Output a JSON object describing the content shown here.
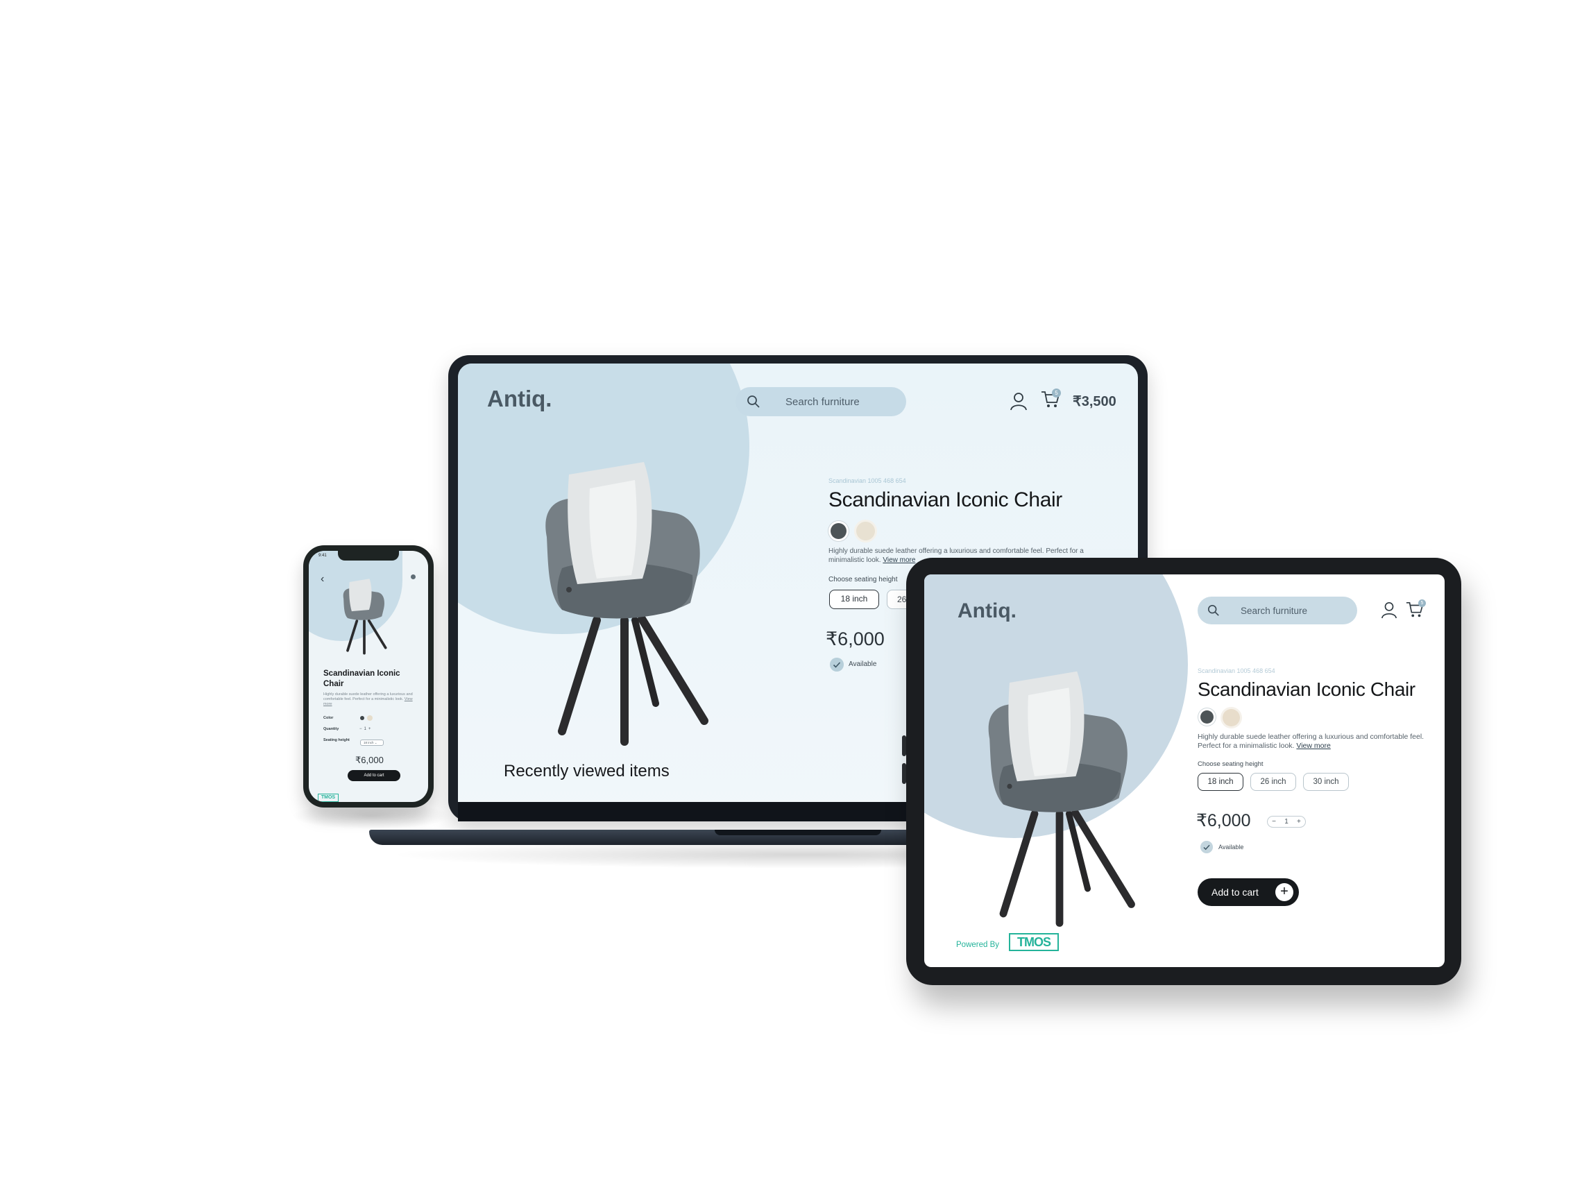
{
  "laptop": {
    "logo": "Antiq.",
    "search_placeholder": "Search furniture",
    "cart_badge": "5",
    "cart_total": "₹3,500",
    "sku": "Scandinavian 1005 468 654",
    "title": "Scandinavian Iconic Chair",
    "description": "Highly durable suede leather offering a luxurious and comfortable feel. Perfect for a minimalistic look.",
    "view_more": "View more",
    "seating_label": "Choose seating height",
    "seating_options": [
      "18 inch",
      "26 inch"
    ],
    "price": "₹6,000",
    "availability": "Available",
    "recently_viewed": "Recently viewed items",
    "colors": [
      "#4d5457",
      "#e8e1d2"
    ]
  },
  "phone": {
    "status_time": "9:41",
    "title": "Scandinavian Iconic Chair",
    "description": "Highly durable suede leather offering a luxurious and comfortable feel. Perfect for a minimalistic look.",
    "view_more": "View more",
    "color_label": "Color",
    "quantity_label": "Quantity",
    "quantity_value": "1",
    "seating_label": "Seating height",
    "seating_value": "18 inch",
    "price": "₹6,000",
    "add_to_cart": "Add to cart",
    "brand": "TMOS"
  },
  "tablet": {
    "logo": "Antiq.",
    "search_placeholder": "Search furniture",
    "cart_badge": "5",
    "sku": "Scandinavian 1005 468 654",
    "title": "Scandinavian Iconic Chair",
    "description": "Highly durable suede leather offering a luxurious and comfortable feel. Perfect for a minimalistic look.",
    "view_more": "View more",
    "seating_label": "Choose seating height",
    "seating_options": [
      "18 inch",
      "26 inch",
      "30 inch"
    ],
    "price": "₹6,000",
    "quantity_value": "1",
    "availability": "Available",
    "add_to_cart": "Add to cart",
    "powered_by": "Powered By",
    "brand": "TMOS"
  }
}
